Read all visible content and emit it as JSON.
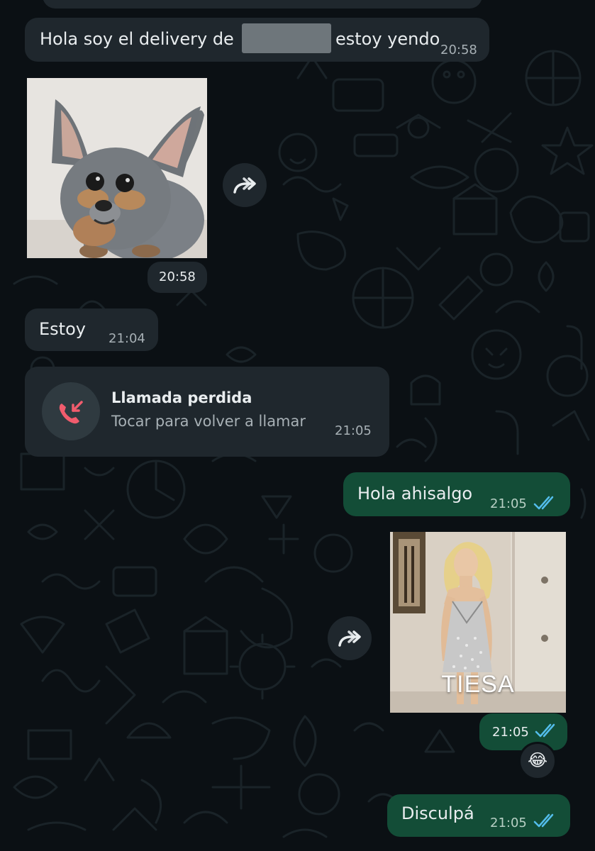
{
  "messages": {
    "delivery": {
      "text_before": "Hola soy el delivery de",
      "text_after": "estoy yendo",
      "time": "20:58"
    },
    "dog_photo": {
      "time": "20:58",
      "subject": "chihuahua puppy photo"
    },
    "estoy": {
      "text": "Estoy",
      "time": "21:04"
    },
    "missed_call": {
      "title": "Llamada perdida",
      "subtitle": "Tocar para volver a llamar",
      "time": "21:05"
    },
    "hola_ahisalgo": {
      "text": "Hola ahisalgo",
      "time": "21:05"
    },
    "tiesa_photo": {
      "caption": "TIESA",
      "time": "21:05",
      "reaction": "😂"
    },
    "disculpa": {
      "text": "Disculpá",
      "time": "21:05"
    }
  },
  "colors": {
    "background": "#0b1014",
    "incoming_bubble": "#1f272d",
    "outgoing_bubble": "#134d37",
    "read_ticks": "#53bdeb",
    "missed_call_red": "#f15c6d"
  },
  "icons": {
    "forward": "forward-icon",
    "missed_call": "missed-call-icon",
    "read_receipt": "double-check-icon"
  }
}
